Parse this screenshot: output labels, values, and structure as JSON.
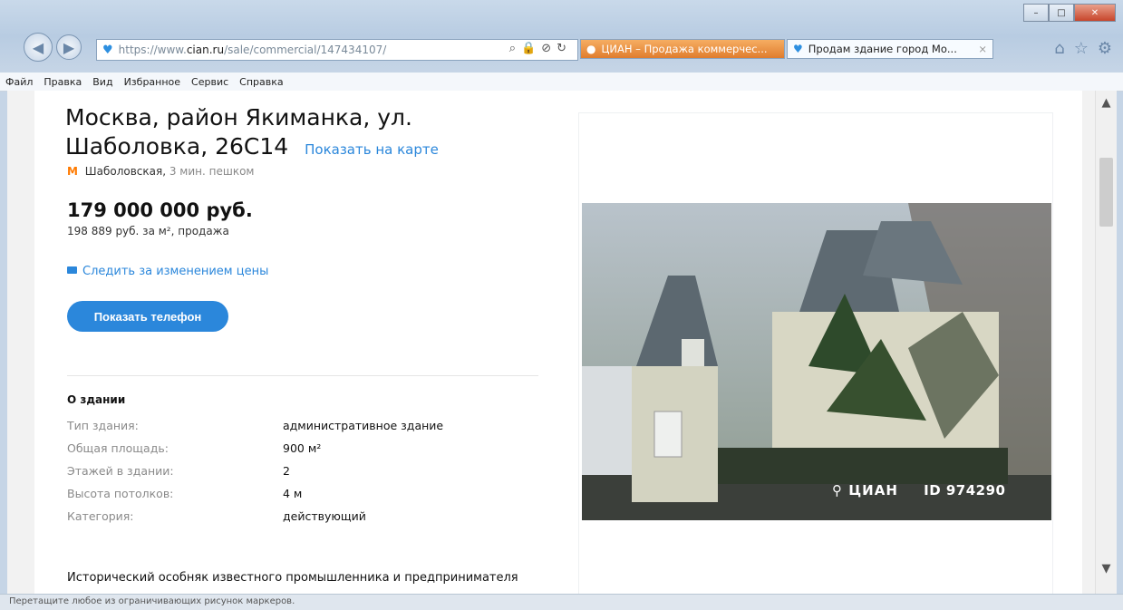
{
  "browser": {
    "url_prefix": "https://www.",
    "url_host": "cian.ru",
    "url_path": "/sale/commercial/147434107/",
    "tabs": [
      {
        "label": "ЦИАН – Продажа коммерчес..."
      },
      {
        "label": "Продам здание город Мо...",
        "close": "×"
      }
    ],
    "menu": [
      "Файл",
      "Правка",
      "Вид",
      "Избранное",
      "Сервис",
      "Справка"
    ],
    "status_text": "Перетащите любое из ограничивающих рисунок маркеров."
  },
  "listing": {
    "address": "Москва, район Якиманка, ул. Шаболовка, 26С14",
    "map_link": "Показать на карте",
    "metro_station": "Шаболовская,",
    "metro_walk": "3 мин. пешком",
    "price": "179 000 000 руб.",
    "price_sub": "198 889 руб. за м², продажа",
    "watch_price": "Следить за изменением цены",
    "phone_button": "Показать телефон",
    "about_title": "О здании",
    "params": [
      {
        "label": "Тип здания:",
        "value": "административное здание"
      },
      {
        "label": "Общая площадь:",
        "value": "900 м²"
      },
      {
        "label": "Этажей в здании:",
        "value": "2"
      },
      {
        "label": "Высота потолков:",
        "value": "4 м"
      },
      {
        "label": "Категория:",
        "value": "действующий"
      }
    ],
    "description": "Исторический особняк известного промышленника и предпринимателя",
    "watermark_brand": "ЦИАН",
    "watermark_id": "ID 974290"
  },
  "colors": {
    "accent": "#2b87db",
    "metro": "#ff7a00"
  }
}
